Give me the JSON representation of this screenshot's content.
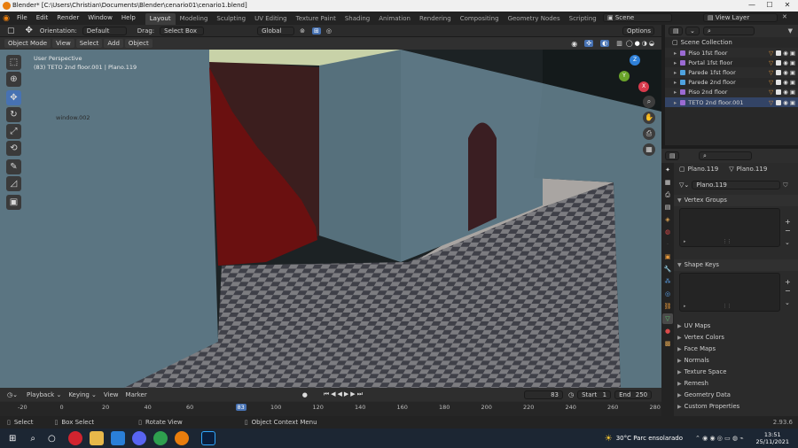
{
  "window": {
    "title": "Blender* [C:\\Users\\Christian\\Documents\\Blender\\cenario01\\cenario1.blend]",
    "minimize": "—",
    "maximize": "☐",
    "close": "✕"
  },
  "menu": [
    "File",
    "Edit",
    "Render",
    "Window",
    "Help"
  ],
  "workspaces": [
    "Layout",
    "Modeling",
    "Sculpting",
    "UV Editing",
    "Texture Paint",
    "Shading",
    "Animation",
    "Rendering",
    "Compositing",
    "Geometry Nodes",
    "Scripting"
  ],
  "add_tab": "+",
  "scene": {
    "name": "Scene",
    "view_layer": "View Layer"
  },
  "tool_header": {
    "orientation_label": "Orientation:",
    "orientation": "Default",
    "drag_label": "Drag:",
    "drag": "Select Box",
    "transform": "Global",
    "options": "Options"
  },
  "viewport_header": {
    "mode": "Object Mode",
    "view": "View",
    "select": "Select",
    "add": "Add",
    "object": "Object"
  },
  "viewport": {
    "perspective": "User Perspective",
    "active": "(83) TETO 2nd floor.001 | Plano.119",
    "label_window": "window.002",
    "gizmo": {
      "x": "X",
      "y": "Y",
      "z": "Z"
    }
  },
  "outliner": {
    "title": "Scene Collection",
    "items": [
      {
        "name": "Piso 1fst floor",
        "color": "#9b6bd3"
      },
      {
        "name": "Portal 1fst floor",
        "color": "#9b6bd3"
      },
      {
        "name": "Parede 1fst floor",
        "color": "#4fa3e0"
      },
      {
        "name": "Parede 2nd floor",
        "color": "#4fa3e0"
      },
      {
        "name": "Piso 2nd floor",
        "color": "#9b6bd3"
      },
      {
        "name": "TETO 2nd floor.001",
        "color": "#9b6bd3"
      }
    ]
  },
  "properties": {
    "object_name": "Plano.119",
    "mesh_name": "Plano.119",
    "data_name": "Plano.119",
    "sections": [
      "Vertex Groups",
      "Shape Keys",
      "UV Maps",
      "Vertex Colors",
      "Face Maps",
      "Normals",
      "Texture Space",
      "Remesh",
      "Geometry Data",
      "Custom Properties"
    ]
  },
  "timeline": {
    "playback": "Playback",
    "keying": "Keying",
    "view": "View",
    "marker": "Marker",
    "current": "83",
    "start_label": "Start",
    "start": "1",
    "end_label": "End",
    "end": "250",
    "ticks": [
      "-20",
      "0",
      "20",
      "40",
      "60",
      "83",
      "100",
      "120",
      "140",
      "160",
      "180",
      "200",
      "220",
      "240",
      "260",
      "280"
    ]
  },
  "status": {
    "select": "Select",
    "box_select": "Box Select",
    "rotate": "Rotate View",
    "context": "Object Context Menu",
    "version": "2.93.6"
  },
  "taskbar": {
    "weather": "30°C  Parc ensolarado",
    "time": "13:51",
    "date": "25/11/2021"
  }
}
